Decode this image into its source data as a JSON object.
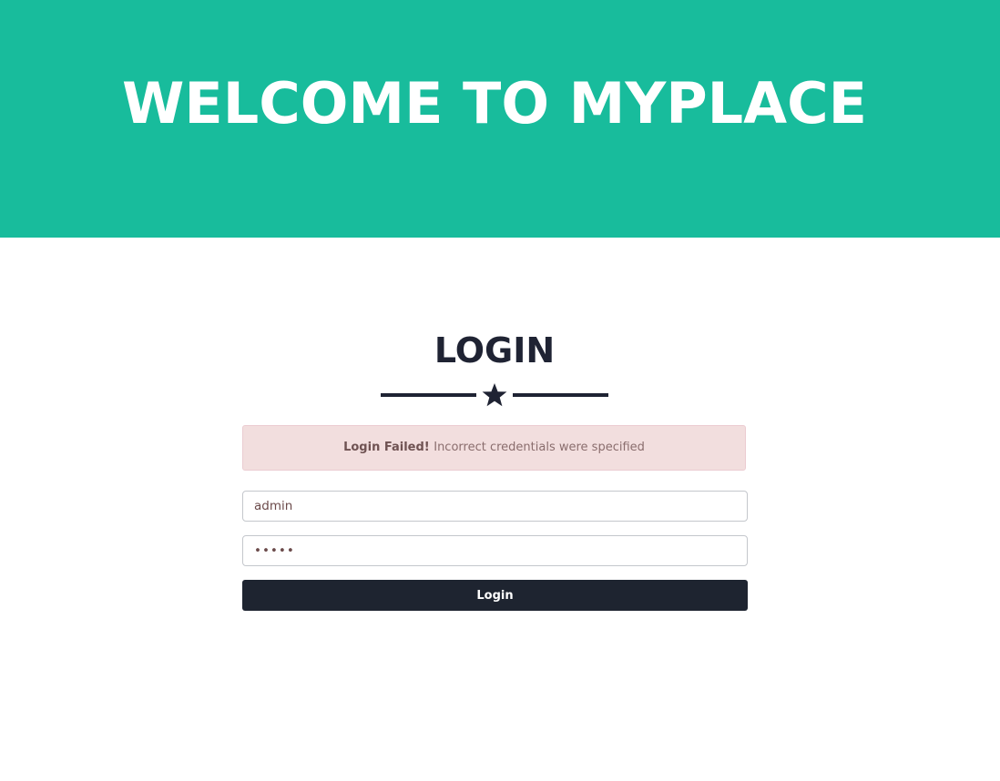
{
  "hero": {
    "title": "WELCOME TO MYPLACE",
    "background_color": "#18bc9c"
  },
  "login": {
    "heading": "LOGIN",
    "divider_icon": "star-icon",
    "alert": {
      "strong_text": "Login Failed! ",
      "message": "Incorrect credentials were specified",
      "background_color": "#f2dede"
    },
    "username_value": "admin",
    "password_value": "admin",
    "button_label": "Login",
    "button_color": "#1e2430"
  }
}
